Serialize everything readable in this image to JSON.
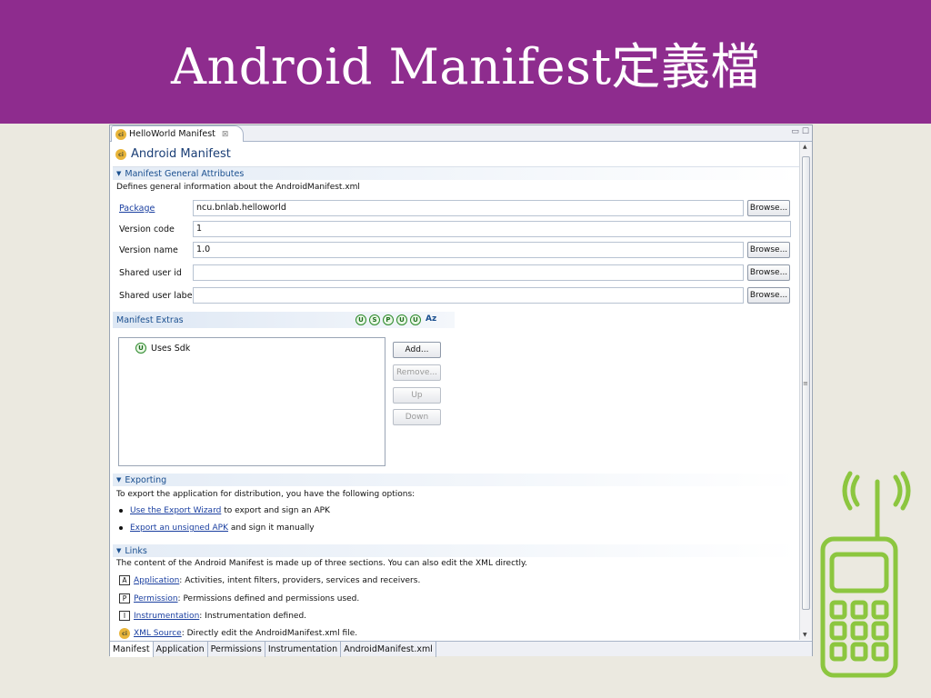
{
  "slide": {
    "title": "Android Manifest定義檔"
  },
  "editor": {
    "tab_label": "HelloWorld Manifest",
    "tab_close": "⊠",
    "win_min": "▭",
    "win_max": "☐",
    "icon_letters": "ci",
    "heading": "Android Manifest"
  },
  "general": {
    "section_title": "Manifest General Attributes",
    "description": "Defines general information about the AndroidManifest.xml",
    "fields": [
      {
        "label": "Package",
        "value": "ncu.bnlab.helloworld",
        "button": "Browse..."
      },
      {
        "label": "Version code",
        "value": "1"
      },
      {
        "label": "Version name",
        "value": "1.0",
        "button": "Browse..."
      },
      {
        "label": "Shared user id",
        "value": "",
        "button": "Browse..."
      },
      {
        "label": "Shared user label",
        "value": "",
        "button": "Browse..."
      }
    ]
  },
  "extras": {
    "title": "Manifest Extras",
    "filter_icons": [
      "U",
      "S",
      "P",
      "U",
      "U"
    ],
    "sort_label": "Az",
    "tree_item_icon": "U",
    "tree_item": "Uses Sdk",
    "buttons": {
      "add": "Add...",
      "remove": "Remove...",
      "up": "Up",
      "down": "Down"
    }
  },
  "exporting": {
    "section_title": "Exporting",
    "description": "To export the application for distribution, you have the following options:",
    "items": [
      {
        "link": "Use the Export Wizard",
        "text": " to export and sign an APK"
      },
      {
        "link": "Export an unsigned APK",
        "text": " and sign it manually"
      }
    ]
  },
  "links": {
    "section_title": "Links",
    "description": "The content of the Android Manifest is made up of three sections. You can also edit the XML directly.",
    "items": [
      {
        "icon": "A",
        "link": "Application",
        "text": ": Activities, intent filters, providers, services and receivers."
      },
      {
        "icon": "P",
        "link": "Permission",
        "text": ": Permissions defined and permissions used."
      },
      {
        "icon": "I",
        "link": "Instrumentation",
        "text": ": Instrumentation defined."
      },
      {
        "icon": "ci",
        "link": "XML Source",
        "text": ": Directly edit the AndroidManifest.xml file."
      }
    ]
  },
  "bottom_tabs": [
    "Manifest",
    "Application",
    "Permissions",
    "Instrumentation",
    "AndroidManifest.xml"
  ],
  "colors": {
    "title_bar": "#8e2c8e",
    "slide_bg": "#ebe9e0",
    "link": "#1a3fa0",
    "section": "#1a4f8f",
    "phone": "#8cc63f"
  }
}
